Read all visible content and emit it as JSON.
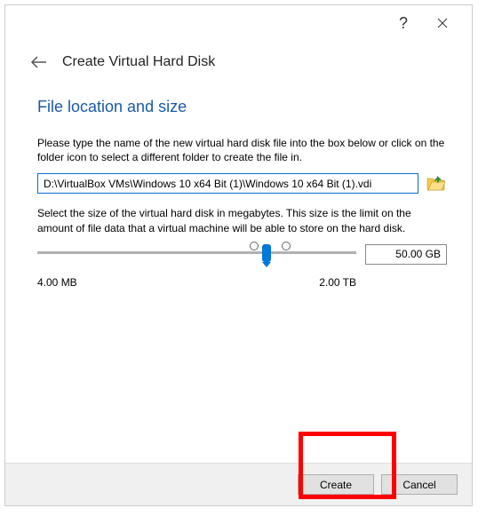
{
  "header": {
    "title": "Create Virtual Hard Disk"
  },
  "section": {
    "title": "File location and size",
    "description1": "Please type the name of the new virtual hard disk file into the box below or click on the folder icon to select a different folder to create the file in.",
    "description2": "Select the size of the virtual hard disk in megabytes. This size is the limit on the amount of file data that a virtual machine will be able to store on the hard disk."
  },
  "file": {
    "path": "D:\\VirtualBox VMs\\Windows 10 x64 Bit (1)\\Windows 10 x64 Bit (1).vdi"
  },
  "slider": {
    "min_label": "4.00 MB",
    "max_label": "2.00 TB",
    "value_display": "50.00 GB"
  },
  "footer": {
    "create_label": "Create",
    "cancel_label": "Cancel"
  }
}
